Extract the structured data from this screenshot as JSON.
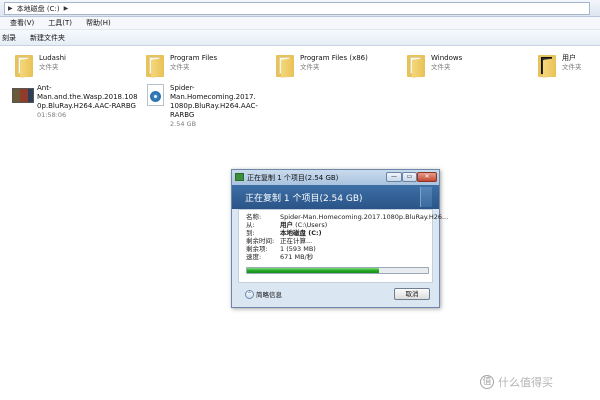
{
  "address_bar": {
    "crumb": "本地磁盘 (C:)"
  },
  "menu": {
    "items": [
      "查看(V)",
      "工具(T)",
      "帮助(H)"
    ]
  },
  "toolbar": {
    "items": [
      "刻录",
      "新建文件夹"
    ]
  },
  "files": [
    {
      "name": "Ludashi",
      "sub": "文件夹",
      "icon": "folder-icon"
    },
    {
      "name": "Program Files",
      "sub": "文件夹",
      "icon": "folder-icon"
    },
    {
      "name": "Program Files (x86)",
      "sub": "文件夹",
      "icon": "folder-icon"
    },
    {
      "name": "Windows",
      "sub": "文件夹",
      "icon": "folder-icon"
    },
    {
      "name": "用户",
      "sub": "文件夹",
      "icon": "folder-icon"
    },
    {
      "name_line1": "Ant-Man.and.the.Wasp.2018.108",
      "name_line2": "0p.BluRay.H264.AAC-RARBG",
      "sub": "01:58:06",
      "icon": "video-thumbnail-icon"
    },
    {
      "name_line1": "Spider-Man.Homecoming.2017.",
      "name_line2": "1080p.BluRay.H264.AAC-RARBG",
      "sub": "2.54 GB",
      "icon": "media-file-icon"
    }
  ],
  "dialog": {
    "title": "正在复制 1 个项目(2.54 GB)",
    "header": "正在复制 1 个项目(2.54 GB)",
    "rows": {
      "name_label": "名称:",
      "name_value": "Spider-Man.Homecoming.2017.1080p.BluRay.H26...",
      "from_label": "从:",
      "from_value_bold": "用户",
      "from_value_rest": " (C:\\Users)",
      "to_label": "到:",
      "to_value_bold": "本地磁盘 (C:)",
      "time_label": "剩余时间:",
      "time_value": "正在计算...",
      "items_label": "剩余项:",
      "items_value": "1 (593 MB)",
      "speed_label": "速度:",
      "speed_value": "671 MB/秒"
    },
    "progress_percent": 73,
    "more_info_label": "简略信息",
    "cancel_label": "取消"
  },
  "watermark": {
    "text": "什么值得买",
    "logo": "值"
  }
}
